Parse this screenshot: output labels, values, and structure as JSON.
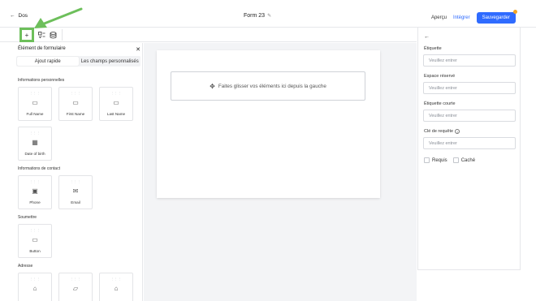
{
  "header": {
    "back_label": "Dos",
    "form_title": "Form 23",
    "apercu_label": "Aperçu",
    "integrer_label": "Intégrer",
    "save_label": "Sauvegarder"
  },
  "toolbar": {
    "add_icon": "plus-icon",
    "tool2_icon": "fields-icon",
    "tool3_icon": "database-icon"
  },
  "left_panel": {
    "title": "Élément de formulaire",
    "tabs": [
      "Ajout rapide",
      "Les champs personnalisés"
    ],
    "sections": [
      {
        "title": "Informations personnelles",
        "items": [
          "Full Name",
          "First Name",
          "Last Name",
          "Date of birth"
        ]
      },
      {
        "title": "Informations de contact",
        "items": [
          "Phone",
          "Email"
        ]
      },
      {
        "title": "Soumettre",
        "items": [
          "Button"
        ]
      },
      {
        "title": "Adresse",
        "items": [
          "",
          "",
          ""
        ]
      }
    ]
  },
  "canvas": {
    "dropzone_text": "Faites glisser vos éléments ici depuis la gauche"
  },
  "right_panel": {
    "fields": [
      {
        "label": "Étiquette",
        "placeholder": "Veuillez entrer"
      },
      {
        "label": "Espace réservé",
        "placeholder": "Veuillez entrer"
      },
      {
        "label": "Étiquette courte",
        "placeholder": "Veuillez entrer"
      },
      {
        "label": "Clé de requête",
        "placeholder": "Veuillez entrer"
      }
    ],
    "requis_label": "Requis",
    "cache_label": "Caché"
  },
  "colors": {
    "accent": "#2f6bff",
    "highlight": "#6dbf5b",
    "badge": "#f6a623"
  }
}
